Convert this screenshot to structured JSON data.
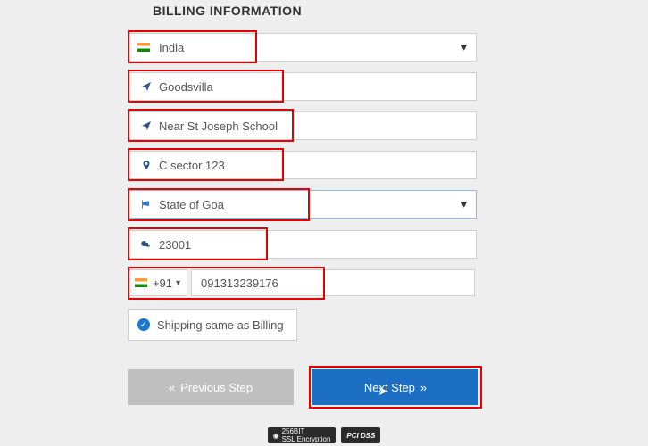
{
  "heading": "BILLING INFORMATION",
  "country": {
    "value": "India"
  },
  "address1": {
    "value": "Goodsvilla"
  },
  "address2": {
    "value": "Near St Joseph School"
  },
  "address3": {
    "value": "C sector 123"
  },
  "state": {
    "value": "State of Goa"
  },
  "postal": {
    "value": "23001"
  },
  "phone": {
    "dial": "+91",
    "number": "091313239176"
  },
  "shipping_same": {
    "label": "Shipping same as Billing"
  },
  "buttons": {
    "prev": "Previous Step",
    "next": "Next Step"
  },
  "badges": {
    "ssl": "256BIT",
    "ssl2": "SSL Encryption",
    "pci": "PCI DSS"
  }
}
